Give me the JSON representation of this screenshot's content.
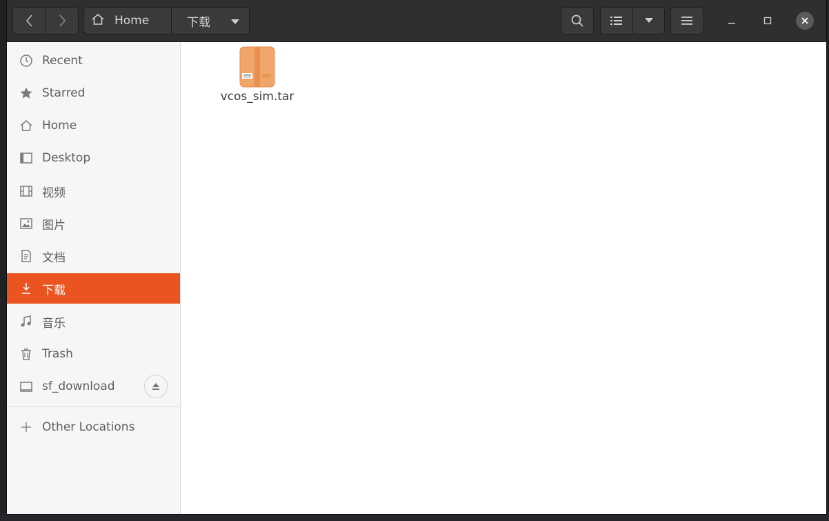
{
  "headerbar": {
    "breadcrumbs": [
      {
        "label": "Home"
      },
      {
        "label": "下载"
      }
    ],
    "icons": {
      "back": "chevron-left-icon",
      "forward": "chevron-right-icon",
      "home": "home-icon",
      "search": "search-icon",
      "view_list": "list-view-icon",
      "view_options": "caret-down-icon",
      "menu": "hamburger-menu-icon"
    }
  },
  "sidebar": {
    "items": [
      {
        "label": "Recent",
        "icon": "clock-icon"
      },
      {
        "label": "Starred",
        "icon": "star-icon"
      },
      {
        "label": "Home",
        "icon": "home-icon"
      },
      {
        "label": "Desktop",
        "icon": "desktop-icon"
      },
      {
        "label": "视频",
        "icon": "video-icon"
      },
      {
        "label": "图片",
        "icon": "picture-icon"
      },
      {
        "label": "文档",
        "icon": "document-icon"
      },
      {
        "label": "下载",
        "icon": "download-icon",
        "active": true
      },
      {
        "label": "音乐",
        "icon": "music-icon"
      },
      {
        "label": "Trash",
        "icon": "trash-icon"
      },
      {
        "label": "sf_download",
        "icon": "drive-icon"
      },
      {
        "label": "Other Locations",
        "icon": "plus-icon"
      }
    ]
  },
  "content": {
    "files": [
      {
        "name": "vcos_sim.tar",
        "icon": "archive-icon"
      }
    ]
  },
  "colors": {
    "accent": "#e95420",
    "headerbar": "#2f2f2f",
    "sidebar": "#f6f6f6"
  }
}
